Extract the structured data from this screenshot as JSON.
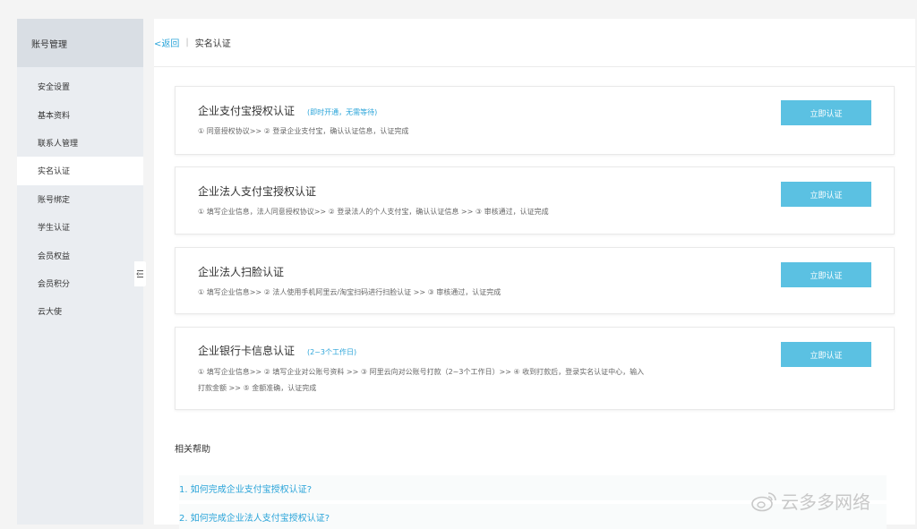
{
  "sidebar": {
    "header": "账号管理",
    "items": [
      {
        "label": "安全设置"
      },
      {
        "label": "基本资料"
      },
      {
        "label": "联系人管理"
      },
      {
        "label": "实名认证",
        "active": true
      },
      {
        "label": "账号绑定"
      },
      {
        "label": "学生认证"
      },
      {
        "label": "会员权益"
      },
      {
        "label": "会员积分"
      },
      {
        "label": "云大使"
      }
    ]
  },
  "breadcrumb": {
    "back": "<返回",
    "sep": "|",
    "current": "实名认证"
  },
  "cards": [
    {
      "title": "企业支付宝授权认证",
      "note": "(即时开通，无需等待)",
      "desc": "① 同意授权协议>> ② 登录企业支付宝，确认认证信息，认证完成",
      "button": "立即认证"
    },
    {
      "title": "企业法人支付宝授权认证",
      "note": "",
      "desc": "① 填写企业信息，法人同意授权协议>> ② 登录法人的个人支付宝，确认认证信息 >> ③ 审核通过，认证完成",
      "button": "立即认证"
    },
    {
      "title": "企业法人扫脸认证",
      "note": "",
      "desc": "① 填写企业信息>> ② 法人使用手机阿里云/淘宝扫码进行扫脸认证 >> ③ 审核通过，认证完成",
      "button": "立即认证"
    },
    {
      "title": "企业银行卡信息认证",
      "note": "(2~3个工作日)",
      "desc": "① 填写企业信息>> ② 填写企业对公账号资料 >> ③ 阿里云向对公账号打款（2~3个工作日）>> ④ 收到打款后，登录实名认证中心，输入打款金额 >> ⑤ 金额准确，认证完成",
      "button": "立即认证"
    }
  ],
  "help": {
    "title": "相关帮助",
    "links": [
      {
        "label": "1. 如何完成企业支付宝授权认证?"
      },
      {
        "label": "2. 如何完成企业法人支付宝授权认证?"
      }
    ]
  },
  "watermark": "云多多网络",
  "colors": {
    "accent": "#2aa4d9",
    "button": "#5bc1e2",
    "sidebar_bg": "#eaedf1"
  }
}
